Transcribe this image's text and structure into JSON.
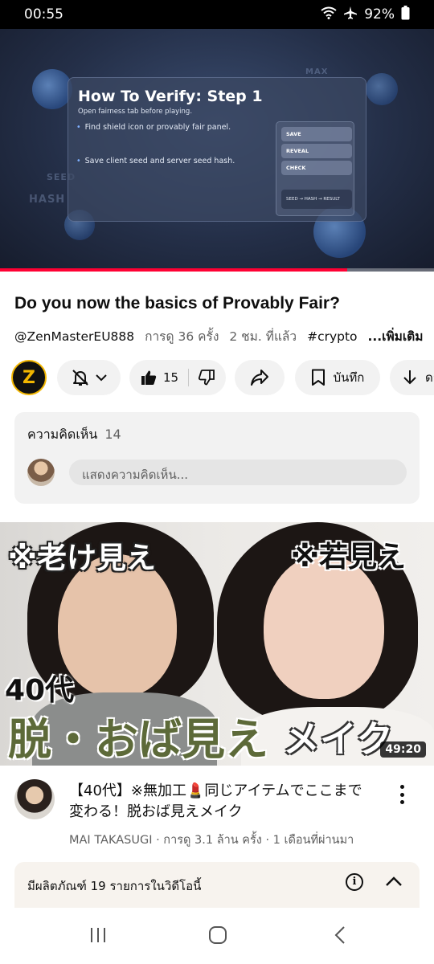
{
  "status_bar": {
    "time": "00:55",
    "battery": "92%"
  },
  "player": {
    "slide_title": "How To Verify: Step 1",
    "slide_subtitle": "Open fairness tab before playing.",
    "bullets": [
      "Find shield icon or provably fair panel.",
      "Save client seed and server seed hash."
    ],
    "panel_buttons": [
      "SAVE",
      "REVEAL",
      "CHECK"
    ],
    "flow_text": "SEED → HASH → RESULT",
    "background_words": [
      "HASH",
      "SEED",
      "MAX"
    ],
    "progress_fraction": 0.8,
    "progress_color": "#ff0033"
  },
  "video": {
    "title": "Do you now the basics of Provably Fair?",
    "channel_handle": "@ZenMasterEU888",
    "views": "การดู 36 ครั้ง",
    "age": "2 ชม. ที่แล้ว",
    "hashtag": "#crypto",
    "more": "...เพิ่มเติม"
  },
  "actions": {
    "channel_avatar_letter": "Z",
    "like_count": "15",
    "save_label": "บันทึก",
    "download_label": "ดา"
  },
  "comments": {
    "label": "ความคิดเห็น",
    "count": "14",
    "placeholder": "แสดงความคิดเห็น..."
  },
  "next_video": {
    "thumb_text_left": "※老け見え",
    "thumb_text_right": "※若見え",
    "thumb_text_age": "40代",
    "thumb_text_main": "脱・おば見え",
    "thumb_text_make": "メイク",
    "duration": "49:20",
    "title": "【40代】※無加工💄同じアイテムでここまで変わる！脱おば見えメイク",
    "channel": "MAI TAKASUGI",
    "views": "การดู 3.1 ล้าน ครั้ง",
    "age": "1 เดือนที่ผ่านมา",
    "separator": "·"
  },
  "products": {
    "label": "มีผลิตภัณฑ์ 19 รายการในวิดีโอนี้",
    "info_icon_text": "i"
  }
}
